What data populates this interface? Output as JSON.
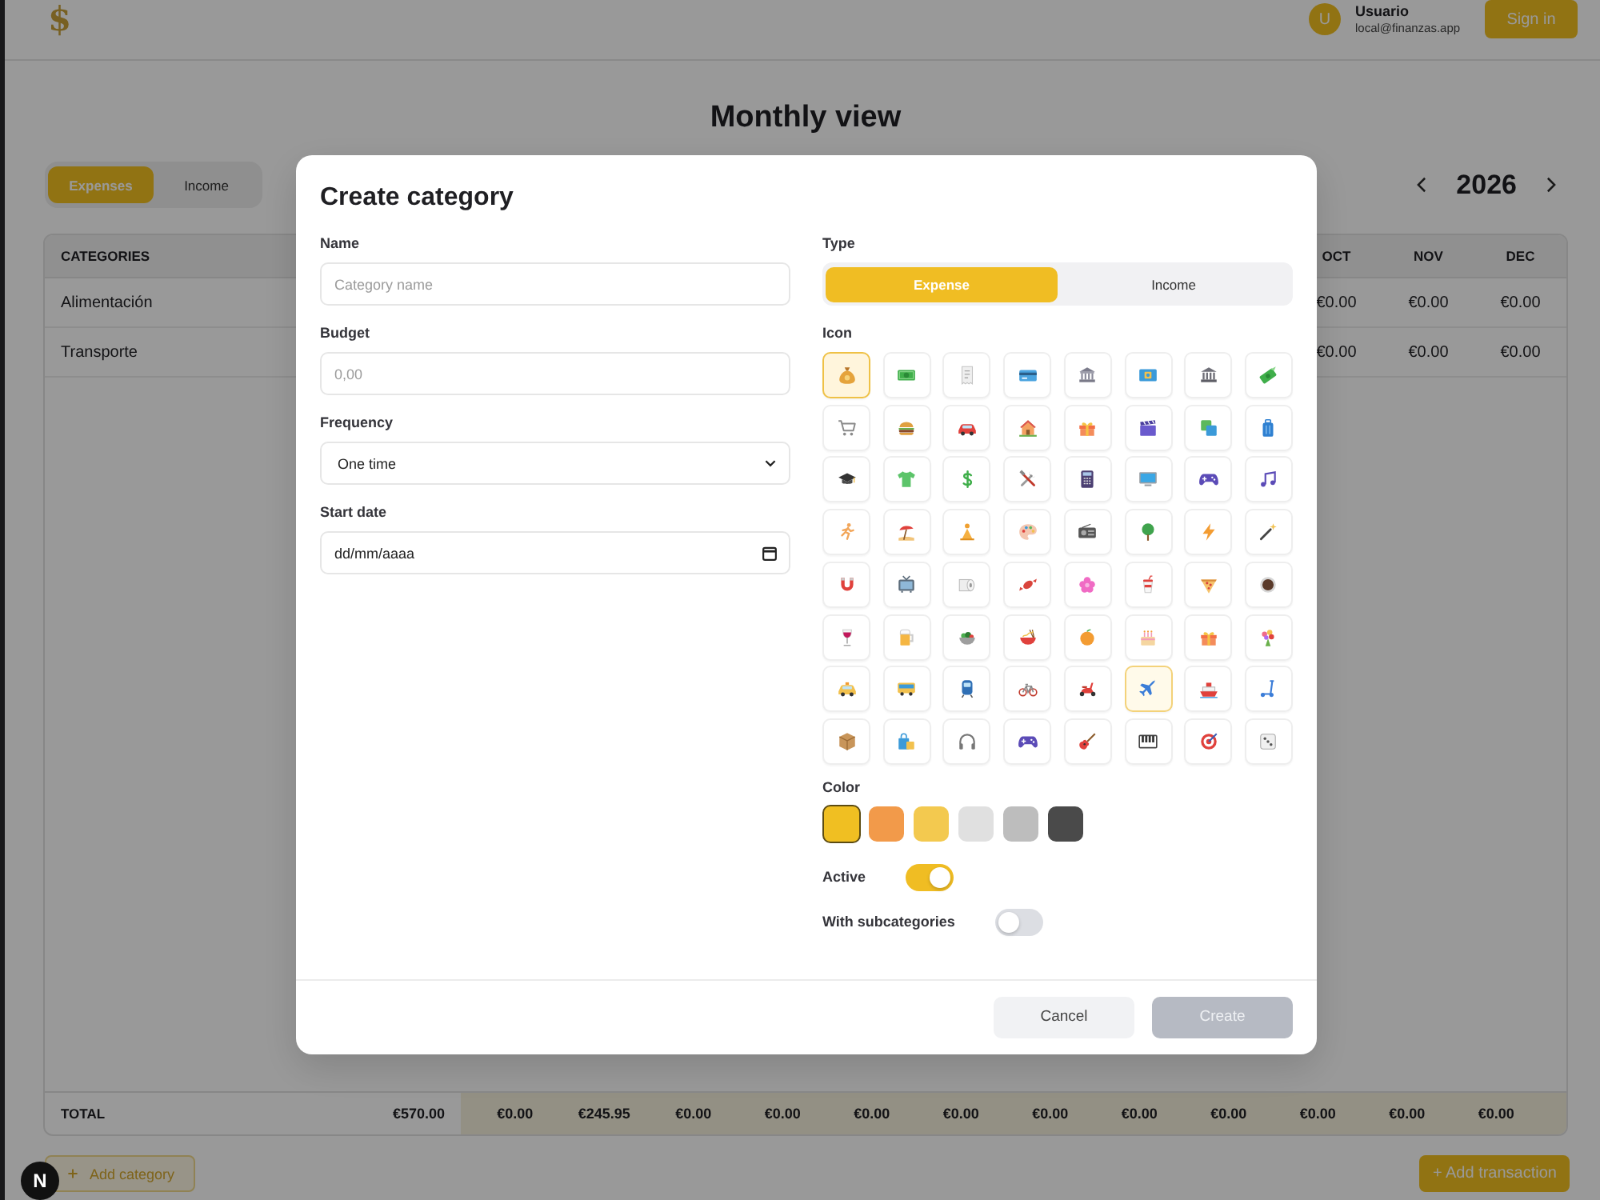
{
  "header": {
    "logo": "$",
    "user": {
      "avatar_initial": "U",
      "name": "Usuario",
      "email": "local@finanzas.app"
    },
    "sign_in": "Sign in"
  },
  "page": {
    "title": "Monthly view",
    "view_tabs": [
      {
        "label": "Expenses",
        "selected": true
      },
      {
        "label": "Income",
        "selected": false
      }
    ],
    "year": "2026"
  },
  "table": {
    "first_column": "CATEGORIES",
    "last_columns": [
      "OCT",
      "NOV",
      "DEC"
    ],
    "rows": [
      {
        "category": "Alimentación",
        "last_values": [
          "€0.00",
          "€0.00",
          "€0.00"
        ]
      },
      {
        "category": "Transporte",
        "last_values": [
          "€0.00",
          "€0.00",
          "€0.00"
        ]
      }
    ],
    "total": {
      "label": "TOTAL",
      "amount": "€570.00",
      "months": [
        "€0.00",
        "€245.95",
        "€0.00",
        "€0.00",
        "€0.00",
        "€0.00",
        "€0.00",
        "€0.00",
        "€0.00",
        "€0.00",
        "€0.00",
        "€0.00"
      ]
    }
  },
  "actions": {
    "add_category": "Add category",
    "add_transaction": "+ Add transaction"
  },
  "dev_indicator": "N",
  "modal": {
    "title": "Create category",
    "fields": [
      {
        "kind": "text",
        "label": "Name",
        "placeholder": "Category name"
      },
      {
        "kind": "text",
        "label": "Budget",
        "placeholder": "0,00"
      },
      {
        "kind": "select",
        "label": "Frequency",
        "value": "One time"
      },
      {
        "kind": "date",
        "label": "Start date",
        "placeholder": "dd/mm/aaaa"
      }
    ],
    "type": {
      "label": "Type",
      "options": [
        {
          "label": "Expense",
          "selected": true
        },
        {
          "label": "Income",
          "selected": false
        }
      ]
    },
    "icon_picker": {
      "label": "Icon",
      "icons": [
        {
          "kind": "moneybag",
          "selected": true,
          "hovered": false
        },
        {
          "kind": "banknote",
          "selected": false,
          "hovered": false
        },
        {
          "kind": "receipt",
          "selected": false,
          "hovered": false
        },
        {
          "kind": "creditcard",
          "selected": false,
          "hovered": false
        },
        {
          "kind": "bank",
          "selected": false,
          "hovered": false
        },
        {
          "kind": "bill",
          "selected": false,
          "hovered": false
        },
        {
          "kind": "temple",
          "selected": false,
          "hovered": false
        },
        {
          "kind": "flyingmoney",
          "selected": false,
          "hovered": false
        },
        {
          "kind": "cart",
          "selected": false,
          "hovered": false
        },
        {
          "kind": "burger",
          "selected": false,
          "hovered": false
        },
        {
          "kind": "car",
          "selected": false,
          "hovered": false
        },
        {
          "kind": "house",
          "selected": false,
          "hovered": false
        },
        {
          "kind": "gift",
          "selected": false,
          "hovered": false
        },
        {
          "kind": "clapper",
          "selected": false,
          "hovered": false
        },
        {
          "kind": "layers",
          "selected": false,
          "hovered": false
        },
        {
          "kind": "luggage",
          "selected": false,
          "hovered": false
        },
        {
          "kind": "gradcap",
          "selected": false,
          "hovered": false
        },
        {
          "kind": "tshirt",
          "selected": false,
          "hovered": false
        },
        {
          "kind": "dollar",
          "selected": false,
          "hovered": false
        },
        {
          "kind": "tools",
          "selected": false,
          "hovered": false
        },
        {
          "kind": "calculator",
          "selected": false,
          "hovered": false
        },
        {
          "kind": "monitor",
          "selected": false,
          "hovered": false
        },
        {
          "kind": "gamepad",
          "selected": false,
          "hovered": false
        },
        {
          "kind": "music",
          "selected": false,
          "hovered": false
        },
        {
          "kind": "runner",
          "selected": false,
          "hovered": false
        },
        {
          "kind": "beach",
          "selected": false,
          "hovered": false
        },
        {
          "kind": "person",
          "selected": false,
          "hovered": false
        },
        {
          "kind": "palette",
          "selected": false,
          "hovered": false
        },
        {
          "kind": "radio",
          "selected": false,
          "hovered": false
        },
        {
          "kind": "tree",
          "selected": false,
          "hovered": false
        },
        {
          "kind": "lightning",
          "selected": false,
          "hovered": false
        },
        {
          "kind": "wand",
          "selected": false,
          "hovered": false
        },
        {
          "kind": "magnet",
          "selected": false,
          "hovered": false
        },
        {
          "kind": "tv",
          "selected": false,
          "hovered": false
        },
        {
          "kind": "toiletpaper",
          "selected": false,
          "hovered": false
        },
        {
          "kind": "candy",
          "selected": false,
          "hovered": false
        },
        {
          "kind": "flower",
          "selected": false,
          "hovered": false
        },
        {
          "kind": "drink",
          "selected": false,
          "hovered": false
        },
        {
          "kind": "pizza",
          "selected": false,
          "hovered": false
        },
        {
          "kind": "coffee",
          "selected": false,
          "hovered": false
        },
        {
          "kind": "wine",
          "selected": false,
          "hovered": false
        },
        {
          "kind": "beer",
          "selected": false,
          "hovered": false
        },
        {
          "kind": "salad",
          "selected": false,
          "hovered": false
        },
        {
          "kind": "noodles",
          "selected": false,
          "hovered": false
        },
        {
          "kind": "citrus",
          "selected": false,
          "hovered": false
        },
        {
          "kind": "cake",
          "selected": false,
          "hovered": false
        },
        {
          "kind": "gift",
          "selected": false,
          "hovered": false
        },
        {
          "kind": "bouquet",
          "selected": false,
          "hovered": false
        },
        {
          "kind": "taxi",
          "selected": false,
          "hovered": false
        },
        {
          "kind": "bus",
          "selected": false,
          "hovered": false
        },
        {
          "kind": "metro",
          "selected": false,
          "hovered": false
        },
        {
          "kind": "bicycle",
          "selected": false,
          "hovered": false
        },
        {
          "kind": "motorscooter",
          "selected": false,
          "hovered": false
        },
        {
          "kind": "airplane",
          "selected": false,
          "hovered": true
        },
        {
          "kind": "ship",
          "selected": false,
          "hovered": false
        },
        {
          "kind": "kickscooter",
          "selected": false,
          "hovered": false
        },
        {
          "kind": "package",
          "selected": false,
          "hovered": false
        },
        {
          "kind": "bags",
          "selected": false,
          "hovered": false
        },
        {
          "kind": "headphones",
          "selected": false,
          "hovered": false
        },
        {
          "kind": "gamepad",
          "selected": false,
          "hovered": false
        },
        {
          "kind": "guitar",
          "selected": false,
          "hovered": false
        },
        {
          "kind": "piano",
          "selected": false,
          "hovered": false
        },
        {
          "kind": "target",
          "selected": false,
          "hovered": false
        },
        {
          "kind": "dice",
          "selected": false,
          "hovered": false
        }
      ]
    },
    "color_picker": {
      "label": "Color",
      "swatches": [
        {
          "color": "#f0bf22",
          "selected": true
        },
        {
          "color": "#f29a4a",
          "selected": false
        },
        {
          "color": "#f3c94f",
          "selected": false
        },
        {
          "color": "#e0e0e0",
          "selected": false
        },
        {
          "color": "#bdbdbd",
          "selected": false
        },
        {
          "color": "#4a4a4a",
          "selected": false
        }
      ]
    },
    "toggles": [
      {
        "label": "Active",
        "on": true
      },
      {
        "label": "With subcategories",
        "on": false
      }
    ],
    "buttons": [
      {
        "kind": "cancel",
        "label": "Cancel",
        "disabled": false
      },
      {
        "kind": "create",
        "label": "Create",
        "disabled": true
      }
    ]
  }
}
